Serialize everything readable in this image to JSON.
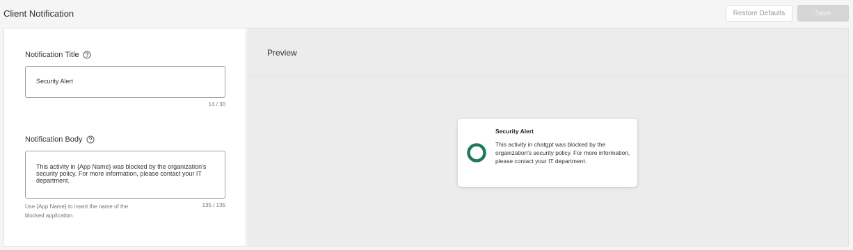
{
  "header": {
    "title": "Client Notification",
    "restore_label": "Restore Defaults",
    "save_label": "Save"
  },
  "form": {
    "title_field": {
      "label": "Notification Title",
      "value": "Security Alert",
      "counter": "14 / 30"
    },
    "body_field": {
      "label": "Notification Body",
      "value": "This activity in {App Name} was blocked by the organization's security policy. For more information, please contact your IT department.",
      "counter": "135 / 135",
      "hint": "Use {App Name} to insert the name of the blocked application."
    }
  },
  "preview": {
    "title": "Preview",
    "notification": {
      "title": "Security Alert",
      "body": "This activity in chatgpt was blocked by the organization's security policy. For more information, please contact your IT department.",
      "icon": "status-ring-icon",
      "icon_color": "#1f7a5a"
    }
  },
  "colors": {
    "page_background": "#f5f5f5",
    "preview_background": "#ececec",
    "accent": "#1f7a5a"
  }
}
